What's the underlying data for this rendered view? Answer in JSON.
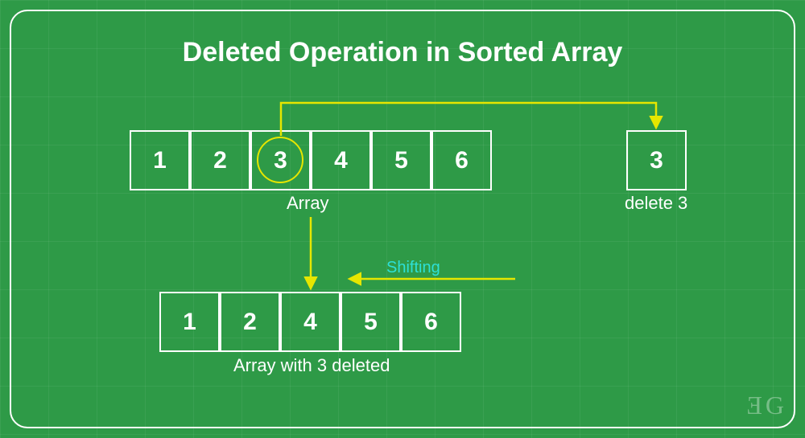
{
  "title": "Deleted Operation in Sorted Array",
  "array1": {
    "cells": [
      "1",
      "2",
      "3",
      "4",
      "5",
      "6"
    ],
    "label": "Array"
  },
  "deleted": {
    "value": "3",
    "label": "delete 3"
  },
  "array2": {
    "cells": [
      "1",
      "2",
      "4",
      "5",
      "6"
    ],
    "label": "Array with 3 deleted"
  },
  "shifting_label": "Shifting",
  "logo": "Ǝ G",
  "colors": {
    "bg": "#2e9a47",
    "accent": "#e6e600",
    "cyan": "#2de0d6"
  }
}
